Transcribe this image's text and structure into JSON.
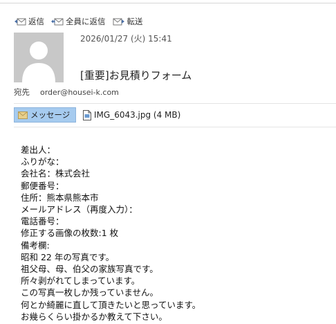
{
  "toolbar": {
    "reply_label": "返信",
    "reply_all_label": "全員に返信",
    "forward_label": "転送"
  },
  "message": {
    "datetime": "2026/01/27 (火) 15:41",
    "subject": "[重要]お見積りフォーム",
    "to_label": "宛先",
    "to_address": "order@housei-k.com"
  },
  "attachments": {
    "message_tab_label": "メッセージ",
    "file_label": "IMG_6043.jpg (4 MB)"
  },
  "body_lines": [
    "差出人：",
    "ふりがな：",
    "会社名：株式会社",
    "郵便番号：",
    "住所：熊本県熊本市",
    "メールアドレス（再度入力）：",
    "電話番号：",
    "修正する画像の枚数:1 枚",
    "備考欄:",
    "昭和 22 年の写真です。",
    "祖父母、母、伯父の家族写真です。",
    "所々剥がれてしまっています。",
    "この写真一枚しか残っていません。",
    "何とか綺麗に直して頂きたいと思っています。",
    "お幾らくらい掛かるか教えて下さい。"
  ]
}
